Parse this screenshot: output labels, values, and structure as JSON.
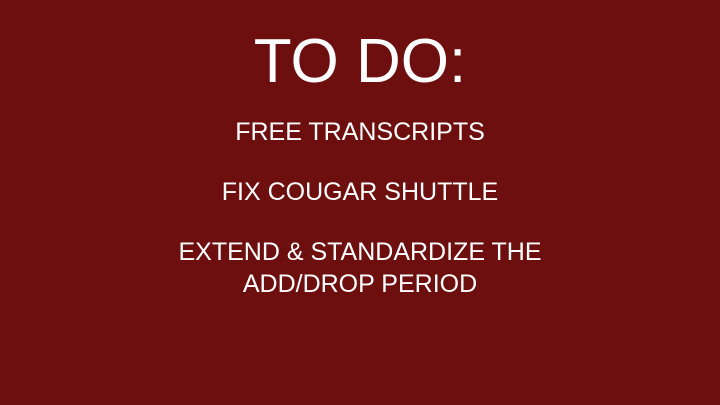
{
  "slide": {
    "title": "TO DO:",
    "items": [
      {
        "lines": [
          "FREE TRANSCRIPTS"
        ]
      },
      {
        "lines": [
          "FIX COUGAR SHUTTLE"
        ]
      },
      {
        "lines": [
          "EXTEND & STANDARDIZE THE",
          "ADD/DROP PERIOD"
        ]
      }
    ]
  },
  "colors": {
    "background": "#6e0f0f",
    "text": "#ffffff"
  }
}
